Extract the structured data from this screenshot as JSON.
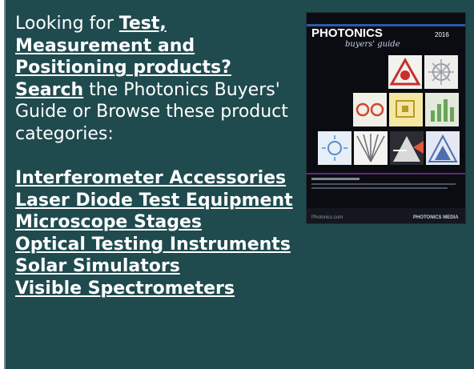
{
  "intro": {
    "prefix": "Looking for ",
    "link": "Test, Measurement and Positioning products?",
    "search_link": "Search",
    "suffix": " the Photonics Buyers' Guide or Browse these product categories:"
  },
  "categories": [
    "Interferometer Accessories",
    "Laser Diode Test Equipment",
    "Microscope Stages",
    "Optical Testing Instruments",
    "Solar Simulators",
    "Visible Spectrometers"
  ],
  "cover": {
    "brand": "PHOTONICS",
    "subtitle": "buyers' guide",
    "year": "2016",
    "footer_left": "Photonics.com",
    "footer_right": "PHOTONICS MEDIA"
  },
  "colors": {
    "panel_bg": "#1f4a4e",
    "link_text": "#ffffff",
    "cover_bg": "#0b0c12",
    "cover_title_bar": "#2a5aa8"
  }
}
